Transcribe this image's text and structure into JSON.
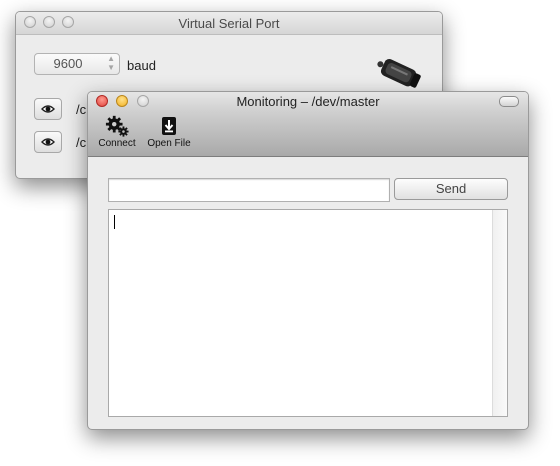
{
  "virtual_serial_port": {
    "title": "Virtual Serial Port",
    "baud_value": "9600",
    "baud_label": "baud",
    "ports": [
      {
        "path": "/c",
        "icon": "eye-icon"
      },
      {
        "path": "/c",
        "icon": "eye-icon"
      }
    ],
    "device_icon": "serial-connector-icon"
  },
  "monitoring": {
    "title": "Monitoring – /dev/master",
    "toolbar": {
      "connect_label": "Connect",
      "connect_icon": "gears-icon",
      "open_file_label": "Open File",
      "open_file_icon": "download-arrow-icon"
    },
    "send_input_value": "",
    "send_button_label": "Send",
    "output_text": ""
  },
  "colors": {
    "close": "#e0443e",
    "minimize": "#f2b223",
    "zoom_inactive": "#c8c8c8"
  }
}
